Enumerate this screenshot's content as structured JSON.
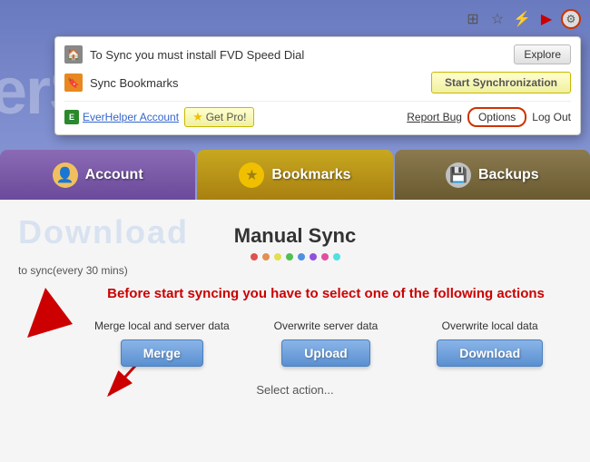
{
  "browser": {
    "toolbar": {
      "icons": [
        "grid-icon",
        "star-icon",
        "lightning-icon",
        "youtube-icon",
        "gear-icon"
      ]
    }
  },
  "popup": {
    "fvd_message": "To Sync you must install FVD Speed Dial",
    "explore_label": "Explore",
    "sync_bookmarks_label": "Sync Bookmarks",
    "start_sync_label": "Start Synchronization",
    "everhelper_label": "EverHelper Account",
    "getpro_label": "Get Pro!",
    "report_bug_label": "Report Bug",
    "options_label": "Options",
    "logout_label": "Log Out"
  },
  "tabs": {
    "account_label": "Account",
    "bookmarks_label": "Bookmarks",
    "backups_label": "Backups"
  },
  "content": {
    "title": "Manual Sync",
    "sync_status": "to sync(every 30 mins)",
    "warning_text": "Before start syncing you have to select one of the following actions",
    "merge_label": "Merge local and server data",
    "merge_btn": "Merge",
    "upload_label": "Overwrite server data",
    "upload_btn": "Upload",
    "download_label": "Overwrite local data",
    "download_btn": "Download",
    "select_action": "Select action...",
    "watermark": "Download"
  },
  "colors": {
    "accent_red": "#cc0000",
    "button_blue": "#5a90d0",
    "tab_purple": "#6a4a9a",
    "tab_gold": "#a88010",
    "tab_brown": "#6a5a30",
    "warning_red": "#cc0000"
  },
  "dots": [
    {
      "color": "#e05050"
    },
    {
      "color": "#e09050"
    },
    {
      "color": "#e0e050"
    },
    {
      "color": "#50c050"
    },
    {
      "color": "#5090e0"
    },
    {
      "color": "#9050e0"
    },
    {
      "color": "#e050a0"
    },
    {
      "color": "#50e0e0"
    }
  ]
}
